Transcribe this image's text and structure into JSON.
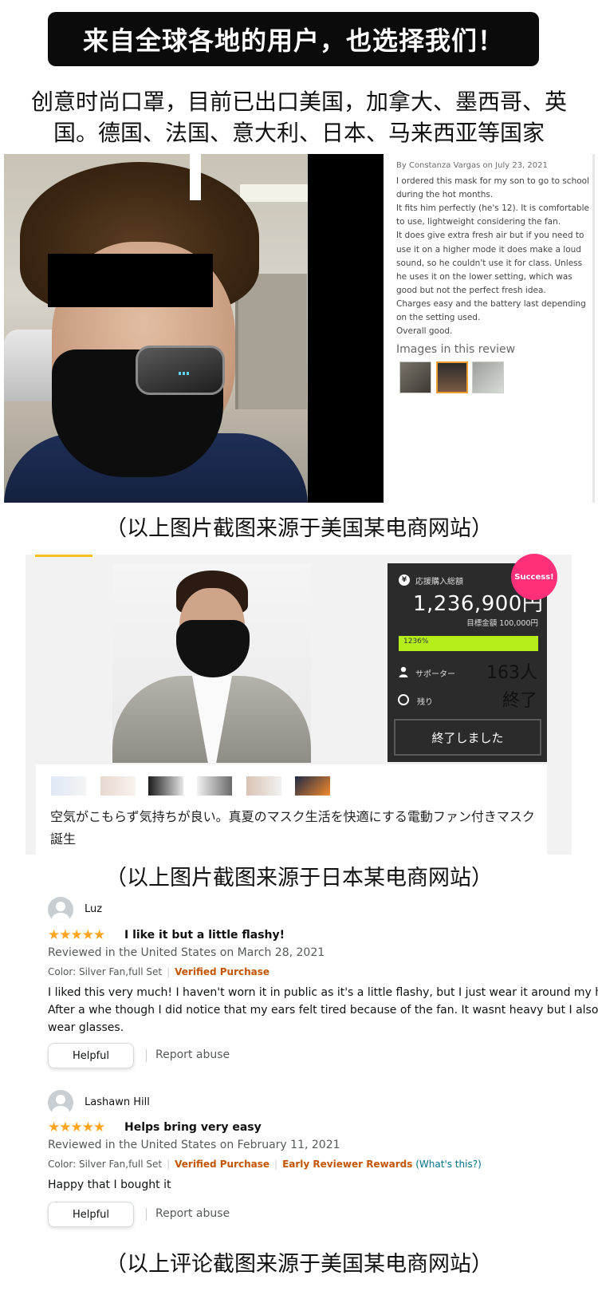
{
  "banner": "来自全球各地的用户，也选择我们！",
  "intro": {
    "line1": "创意时尚口罩，目前已出口美国，加拿大、墨西哥、英",
    "line2": "国。德国、法国、意大利、日本、马来西亚等国家"
  },
  "us_review": {
    "by": "By Constanza Vargas on July 23, 2021",
    "body": [
      "I ordered this mask for my son to go to school",
      "during the hot months.",
      "It fits him perfectly (he's 12). It is comfortable",
      "to use, lightweight considering the fan.",
      "It does give extra fresh air but if you need to",
      "use it on a higher mode it does make a loud",
      "sound, so he couldn't use it for class. Unless",
      "he uses it on the lower setting, which was",
      "good but not the perfect fresh idea.",
      "Charges easy and the battery last depending",
      "on the setting used.",
      "Overall good."
    ],
    "images_label": "Images in this review"
  },
  "caption1": "（以上图片截图来源于美国某电商网站）",
  "jp_campaign": {
    "success_badge": "Success!",
    "total_label": "応援購入総額",
    "total_value": "1,236,900円",
    "goal": "目標金額 100,000円",
    "progress_text": "1236%",
    "progress_fraction": 1.0,
    "supporter_label": "サポーター",
    "supporter_value": "163人",
    "remaining_label": "残り",
    "remaining_value": "終了",
    "ended_button": "終了しました",
    "description": "空気がこもらず気持ちが良い。真夏のマスク生活を快適にする電動ファン付きマスク誕生",
    "accent_color": "#b6ee1b",
    "badge_color": "#ff2f7a"
  },
  "caption2": "（以上图片截图来源于日本某电商网站）",
  "reviews": [
    {
      "name": "Luz",
      "stars": "★★★★★",
      "title": "I like it but a little flashy!",
      "date": "Reviewed in the United States on March 28, 2021",
      "color": "Color: Silver Fan,full Set",
      "verified": "Verified Purchase",
      "body1": "I liked this very much! I haven't worn it in public as it's a little flashy, but I just wear it around my hou",
      "body2": "After a whe though I did notice that my ears felt tired because of the fan. It wasnt heavy but I also",
      "body3": "wear glasses.",
      "helpful": "Helpful",
      "report": "Report abuse"
    },
    {
      "name": "Lashawn Hill",
      "stars": "★★★★★",
      "title": "Helps bring very easy",
      "date": "Reviewed in the United States on February 11, 2021",
      "color": "Color: Silver Fan,full Set",
      "verified": "Verified Purchase",
      "early": "Early Reviewer Rewards",
      "whats": "(What's this?)",
      "body1": "Happy that I bought it",
      "helpful": "Helpful",
      "report": "Report abuse"
    }
  ],
  "caption3": "（以上评论截图来源于美国某电商网站）"
}
